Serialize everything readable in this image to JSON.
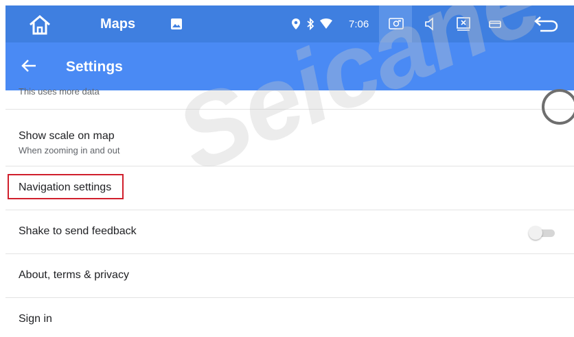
{
  "status_bar": {
    "app_title": "Maps",
    "time": "7:06",
    "icons": [
      "home-icon",
      "image-icon",
      "location-icon",
      "bluetooth-icon",
      "wifi-icon",
      "screenshot-icon",
      "volume-icon",
      "close-window-icon",
      "window-icon",
      "back-arrow-icon"
    ]
  },
  "app_bar": {
    "title": "Settings"
  },
  "settings": {
    "partial_item": {
      "subtitle": "This uses more data"
    },
    "show_scale": {
      "label": "Show scale on map",
      "subtitle": "When zooming in and out"
    },
    "navigation": {
      "label": "Navigation settings"
    },
    "shake_feedback": {
      "label": "Shake to send feedback",
      "toggle_on": false
    },
    "about": {
      "label": "About, terms & privacy"
    },
    "sign_in": {
      "label": "Sign in"
    }
  },
  "watermark": "Seicane",
  "colors": {
    "status_bar": "#3f7fe0",
    "app_bar": "#4a8af4",
    "highlight": "#d01e2b"
  }
}
